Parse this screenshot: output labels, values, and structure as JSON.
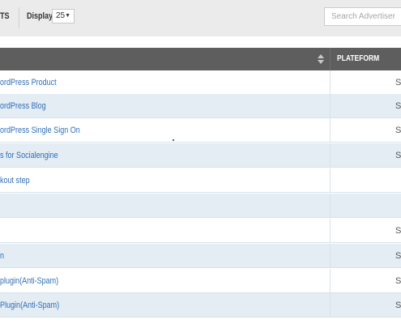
{
  "toolbar": {
    "title_fragment": "TS",
    "display_label": "Display",
    "display_value": "25",
    "search_placeholder": "Search Advertiser"
  },
  "table": {
    "platform_header": "PLATEFORM",
    "rows": [
      {
        "name": "ordPress Product",
        "platform": "S"
      },
      {
        "name": "ordPress Blog",
        "platform": "S"
      },
      {
        "name": "ordPress Single Sign On",
        "platform": "S"
      },
      {
        "name": "s for Socialengine",
        "platform": "S"
      },
      {
        "name": "kout step",
        "platform": ""
      },
      {
        "name": "",
        "platform": ""
      },
      {
        "name": "",
        "platform": "S"
      },
      {
        "name": "n",
        "platform": "S"
      },
      {
        "name": "plugin(Anti-Spam)",
        "platform": "S"
      },
      {
        "name": "Plugin(Anti-Spam)",
        "platform": "S"
      }
    ]
  }
}
